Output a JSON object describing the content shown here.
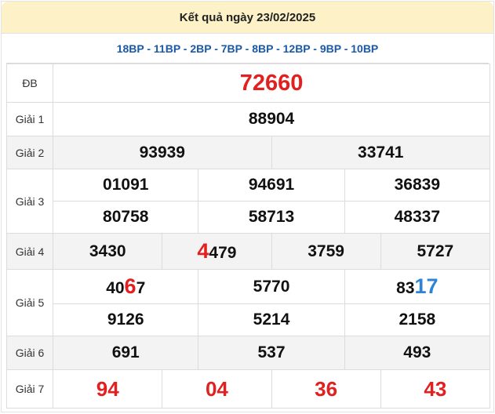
{
  "header": {
    "title": "Kết quả ngày 23/02/2025"
  },
  "codes": "18BP - 11BP - 2BP - 7BP - 8BP - 12BP - 9BP - 10BP",
  "prizes": {
    "db": {
      "label": "ĐB",
      "value": "72660"
    },
    "g1": {
      "label": "Giải 1",
      "value": "88904"
    },
    "g2": {
      "label": "Giải 2",
      "values": [
        "93939",
        "33741"
      ]
    },
    "g3": {
      "label": "Giải 3",
      "values": [
        "01091",
        "94691",
        "36839",
        "80758",
        "58713",
        "48337"
      ]
    },
    "g4": {
      "label": "Giải 4",
      "values": [
        "3430",
        "4479",
        "3759",
        "5727"
      ],
      "v2_head": "4",
      "v2_tail": "479"
    },
    "g5": {
      "label": "Giải 5",
      "values": [
        "4067",
        "5770",
        "8317",
        "9126",
        "5214",
        "2158"
      ],
      "v1_pre": "40",
      "v1_hl": "6",
      "v1_post": "7",
      "v3_pre": "83",
      "v3_hl": "17"
    },
    "g6": {
      "label": "Giải 6",
      "values": [
        "691",
        "537",
        "493"
      ]
    },
    "g7": {
      "label": "Giải 7",
      "values": [
        "94",
        "04",
        "36",
        "43"
      ]
    }
  },
  "colors": {
    "header_bg": "#fdf1c8",
    "red": "#e22020",
    "blue": "#2d83d6",
    "codes": "#1a59a8",
    "row_alt": "#f3f3f3"
  }
}
